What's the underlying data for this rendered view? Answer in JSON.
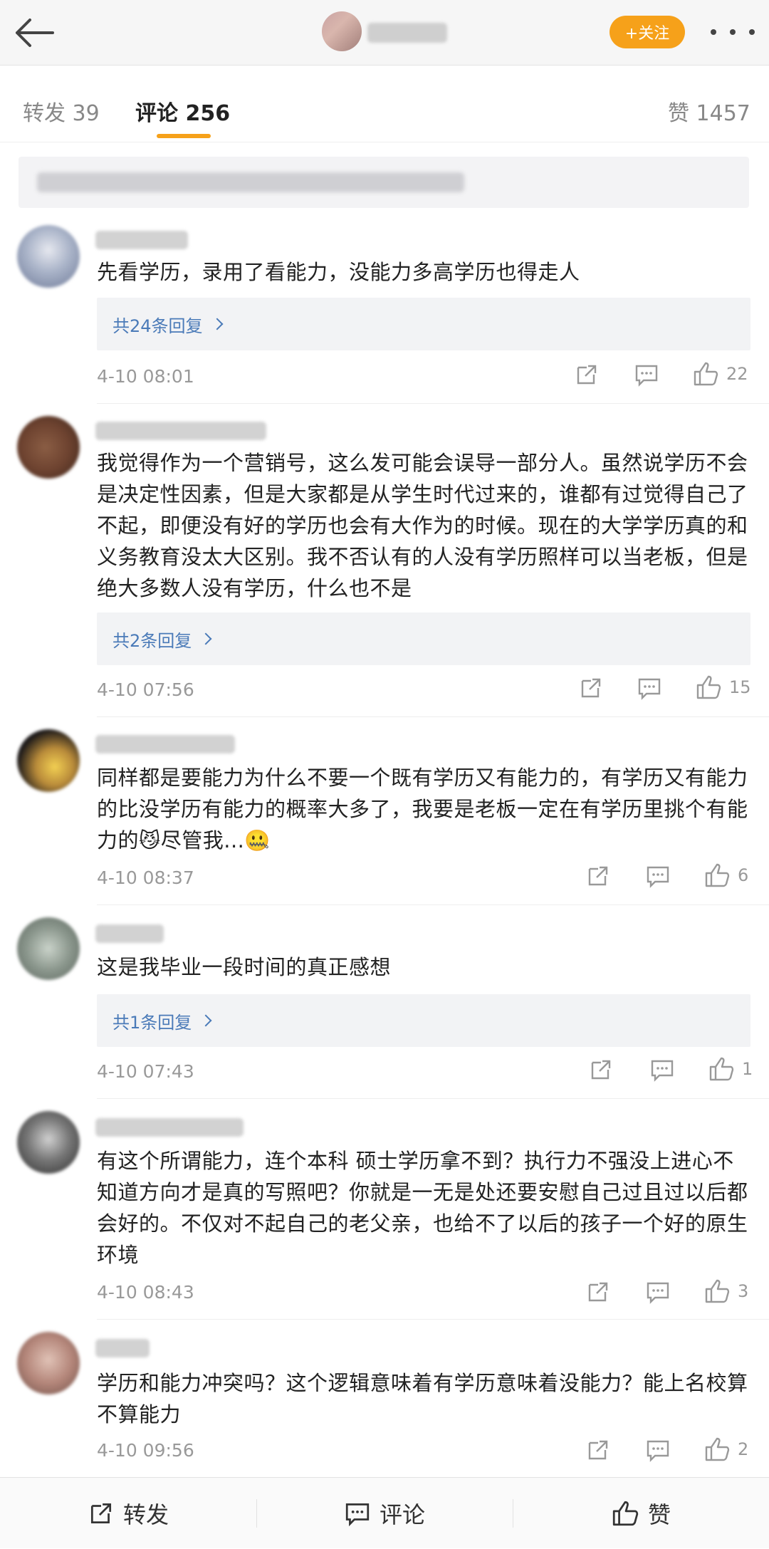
{
  "header": {
    "follow_label": "+关注",
    "back_icon": "arrow-left-icon",
    "more_icon": "more-dots-icon"
  },
  "tabs": {
    "repost": "转发 39",
    "comments": "评论 256",
    "likes": "赞 1457"
  },
  "comments": [
    {
      "text": "先看学历，录用了看能力，没能力多高学历也得走人",
      "replies": "共24条回复",
      "time": "4-10 08:01",
      "likes": "22"
    },
    {
      "text": "我觉得作为一个营销号，这么发可能会误导一部分人。虽然说学历不会是决定性因素，但是大家都是从学生时代过来的，谁都有过觉得自己了不起，即便没有好的学历也会有大作为的时候。现在的大学学历真的和义务教育没太大区别。我不否认有的人没有学历照样可以当老板，但是绝大多数人没有学历，什么也不是",
      "replies": "共2条回复",
      "time": "4-10 07:56",
      "likes": "15"
    },
    {
      "text": "同样都是要能力为什么不要一个既有学历又有能力的，有学历又有能力的比没学历有能力的概率大多了，我要是老板一定在有学历里挑个有能力的😼尽管我...🤐",
      "replies": "",
      "time": "4-10 08:37",
      "likes": "6"
    },
    {
      "text": "这是我毕业一段时间的真正感想",
      "replies": "共1条回复",
      "time": "4-10 07:43",
      "likes": "1"
    },
    {
      "text": "有这个所谓能力，连个本科 硕士学历拿不到？执行力不强没上进心不知道方向才是真的写照吧？你就是一无是处还要安慰自己过且过以后都会好的。不仅对不起自己的老父亲，也给不了以后的孩子一个好的原生环境",
      "replies": "",
      "time": "4-10 08:43",
      "likes": "3"
    },
    {
      "text": "学历和能力冲突吗？这个逻辑意味着有学历意味着没能力？能上名校算不算能力",
      "replies": "",
      "time": "4-10 09:56",
      "likes": "2"
    }
  ],
  "bottom": {
    "repost": "转发",
    "comment": "评论",
    "like": "赞"
  }
}
